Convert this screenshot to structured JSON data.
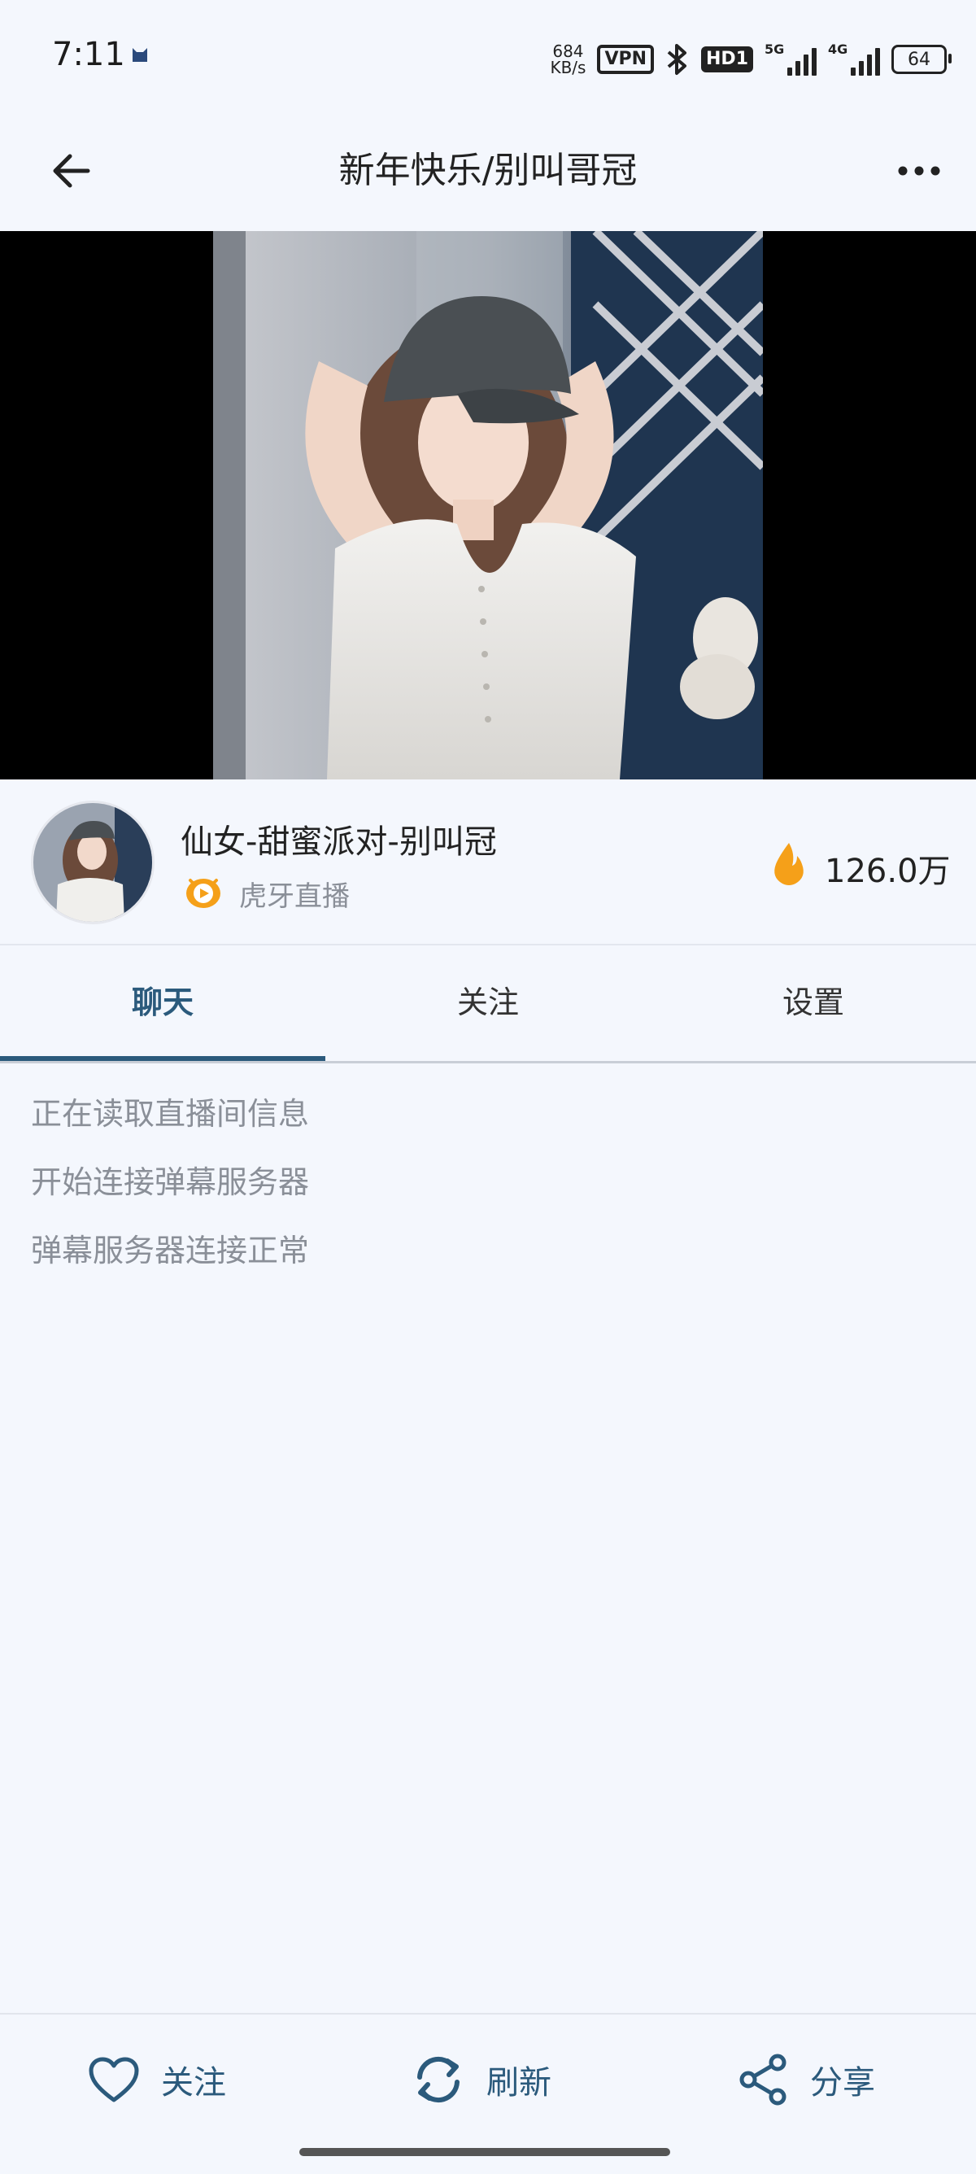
{
  "status_bar": {
    "time": "7:11",
    "net_speed_value": "684",
    "net_speed_unit": "KB/s",
    "vpn": "VPN",
    "hd": "HD1",
    "signal1_label": "5G",
    "signal2_label": "4G",
    "battery": "64"
  },
  "header": {
    "title": "新年快乐/别叫哥冠"
  },
  "streamer": {
    "name": "仙女-甜蜜派对-别叫冠",
    "platform": "虎牙直播",
    "popularity": "126.0万"
  },
  "tabs": [
    {
      "label": "聊天"
    },
    {
      "label": "关注"
    },
    {
      "label": "设置"
    }
  ],
  "messages": [
    "正在读取直播间信息",
    "开始连接弹幕服务器",
    "弹幕服务器连接正常"
  ],
  "bottom_bar": {
    "follow_label": "关注",
    "refresh_label": "刷新",
    "share_label": "分享"
  },
  "colors": {
    "accent": "#2b5a7c",
    "background": "#f4f7fd",
    "fire": "#f5a019"
  }
}
